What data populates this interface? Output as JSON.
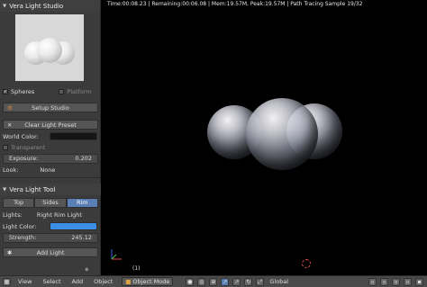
{
  "studio_panel": {
    "title": "Vera Light Studio",
    "spheres_label": "Spheres",
    "platform_label": "Platform",
    "setup_button": "Setup Studio",
    "clear_button": "Clear Light Preset",
    "world_color_label": "World Color:",
    "world_color": "#151515",
    "transparent_label": "Transparent",
    "exposure_label": "Exposure:",
    "exposure_value": "0.202",
    "look_label": "Look:",
    "look_value": "None"
  },
  "light_tool_panel": {
    "title": "Vera Light Tool",
    "tabs": [
      "Top",
      "Sides",
      "Rim"
    ],
    "active_tab": "Rim",
    "lights_label": "Lights:",
    "lights_value": "Right Rim Light",
    "light_color_label": "Light Color:",
    "light_color": "#3a8ee6",
    "strength_label": "Strength:",
    "strength_value": "245.12",
    "add_light_button": "Add Light"
  },
  "viewport": {
    "stats_line": "Time:00:08.23 | Remaining:00:06.08 | Mem:19.57M, Peak:19.57M | Path Tracing Sample 19/32",
    "frame_label": "(1)"
  },
  "bottombar": {
    "menus": [
      "View",
      "Select",
      "Add",
      "Object"
    ],
    "mode": "Object Mode",
    "orientation": "Global"
  }
}
